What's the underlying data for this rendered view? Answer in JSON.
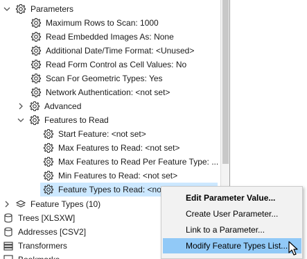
{
  "tree": {
    "parameters": {
      "label": "Parameters",
      "items": [
        "Maximum Rows to Scan: 1000",
        "Read Embedded Images As: None",
        "Additional Date/Time Format: <Unused>",
        "Read Form Control as Cell Values: No",
        "Scan For Geometric Types: Yes",
        "Network Authentication: <not set>"
      ],
      "advanced_label": "Advanced",
      "features_to_read": {
        "label": "Features to Read",
        "items": [
          "Start Feature: <not set>",
          "Max Features to Read: <not set>",
          "Max Features to Read Per Feature Type: ...",
          "Min Features to Read: <not set>",
          "Feature Types to Read: <not set>"
        ]
      }
    },
    "feature_types_label": "Feature Types (10)",
    "trees_label": "Trees [XLSXW]",
    "addresses_label": "Addresses [CSV2]",
    "transformers_label": "Transformers",
    "bookmarks_label": "Bookmarks"
  },
  "context_menu": {
    "items": [
      "Edit Parameter Value...",
      "Create User Parameter...",
      "Link to a Parameter...",
      "Modify Feature Types List..."
    ]
  },
  "colors": {
    "selection": "#cce8ff",
    "menu_highlight": "#91c9f7",
    "menu_background": "#f2f2f2"
  },
  "icons": {
    "parameter": "gear-icon",
    "expand": "chevron-down-icon",
    "collapse": "chevron-right-icon",
    "feature_types": "layers-icon",
    "writer": "cylinder-icon",
    "transformers": "stack-icon"
  }
}
